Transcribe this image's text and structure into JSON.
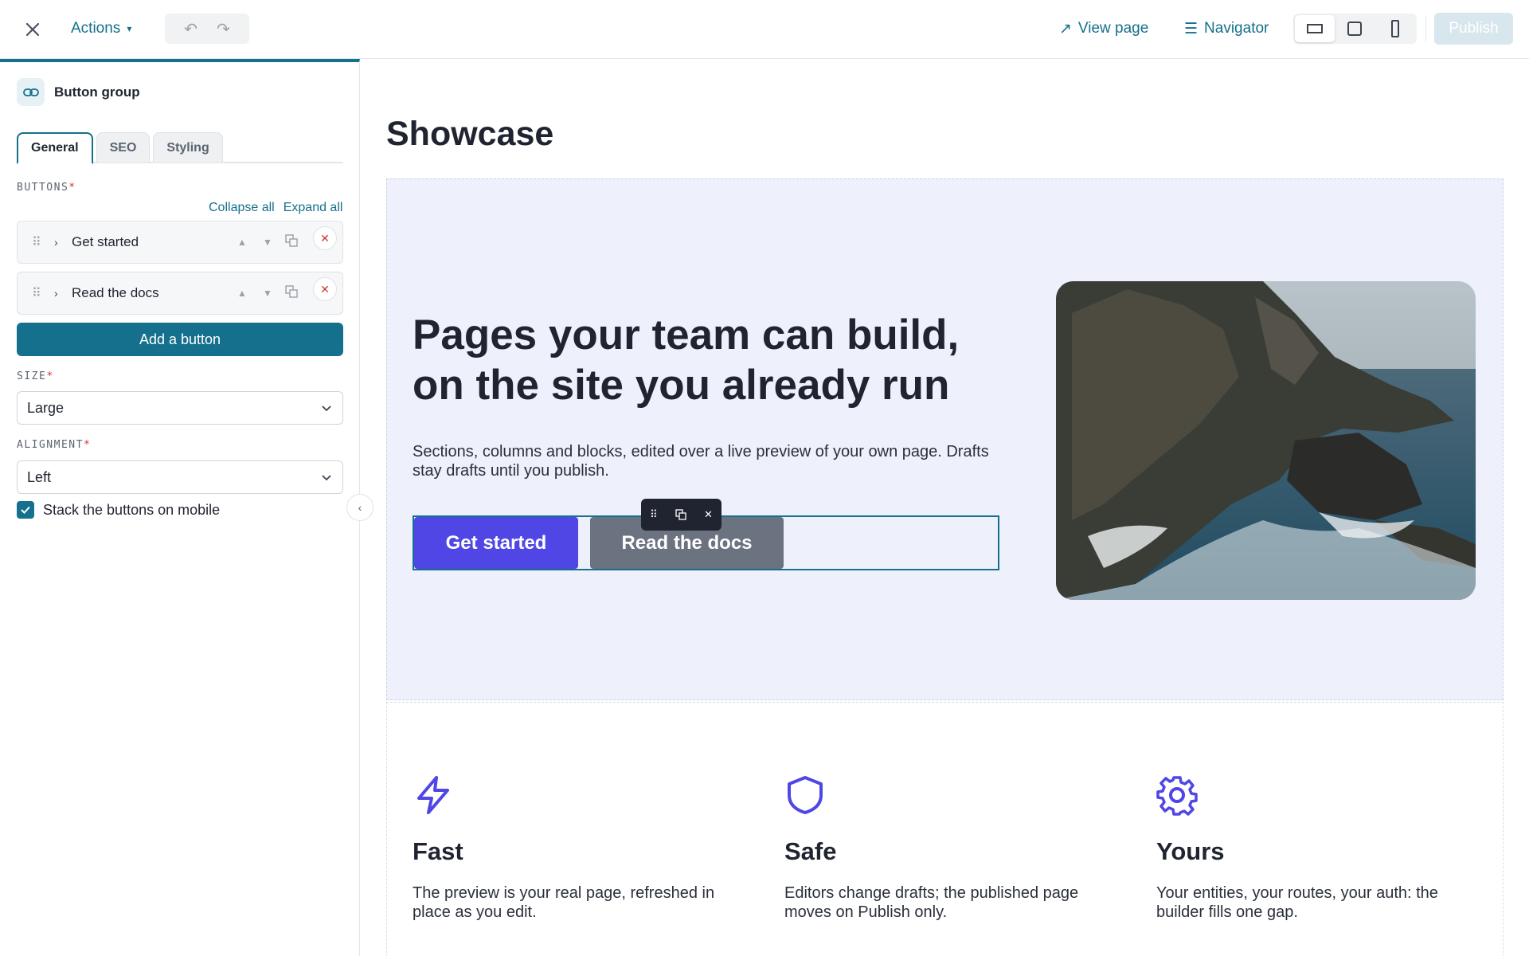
{
  "topbar": {
    "actions_label": "Actions",
    "actions_caret": "▾",
    "undo_glyph": "↶",
    "redo_glyph": "↷",
    "view_page_icon": "↗",
    "view_page_label": "View page",
    "navigator_icon": "☰",
    "navigator_label": "Navigator",
    "devices": [
      "desktop",
      "tablet",
      "mobile"
    ],
    "active_device": "desktop",
    "publish_label": "Publish"
  },
  "sidebar": {
    "block_title": "Button group",
    "tabs": [
      {
        "label": "General",
        "active": true
      },
      {
        "label": "SEO",
        "active": false
      },
      {
        "label": "Styling",
        "active": false
      }
    ],
    "buttons_label": "BUTTONS",
    "required_mark": "*",
    "collapse_all": "Collapse all",
    "expand_all": "Expand all",
    "button_items": [
      {
        "label": "Get started"
      },
      {
        "label": "Read the docs"
      }
    ],
    "add_button_label": "Add a button",
    "size_label": "SIZE",
    "size_value": "Large",
    "alignment_label": "ALIGNMENT",
    "alignment_value": "Left",
    "stack_label": "Stack the buttons on mobile",
    "stack_checked": true
  },
  "preview": {
    "page_title": "Showcase",
    "hero": {
      "heading": "Pages your team can build, on the site you already run",
      "paragraph": "Sections, columns and blocks, edited over a live preview of your own page. Drafts stay drafts until you publish.",
      "primary_cta": "Get started",
      "secondary_cta": "Read the docs",
      "image": "coastal-cliffs-photo"
    },
    "features": [
      {
        "icon": "lightning-icon",
        "title": "Fast",
        "description": "The preview is your real page, refreshed in place as you edit."
      },
      {
        "icon": "shield-icon",
        "title": "Safe",
        "description": "Editors change drafts; the published page moves on Publish only."
      },
      {
        "icon": "gear-icon",
        "title": "Yours",
        "description": "Your entities, your routes, your auth: the builder fills one gap."
      }
    ]
  },
  "colors": {
    "accent": "#14708c",
    "primary_button": "#4f46e5",
    "secondary_button": "#6b7280",
    "hero_background": "#eef1fc",
    "required": "#d0342c"
  }
}
